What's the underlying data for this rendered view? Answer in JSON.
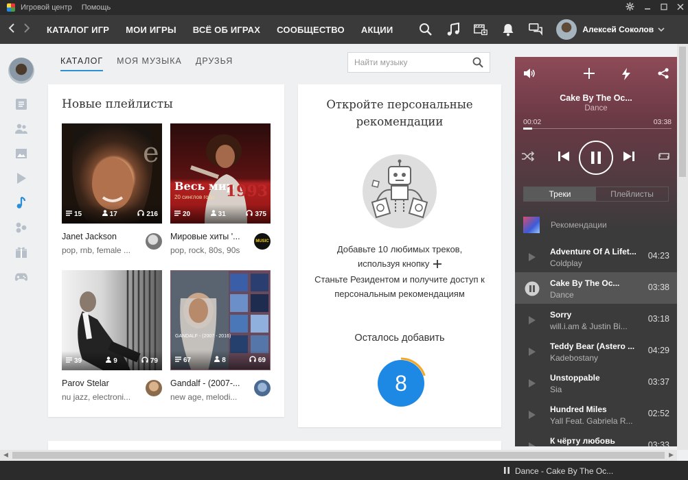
{
  "titlebar": {
    "menu": [
      "Игровой центр",
      "Помощь"
    ]
  },
  "navbar": {
    "items": [
      "КАТАЛОГ ИГР",
      "МОИ ИГРЫ",
      "ВСЁ ОБ ИГРАХ",
      "СООБЩЕСТВО",
      "АКЦИИ"
    ],
    "icons": [
      "search-icon",
      "music-icon",
      "video-icon",
      "bell-icon",
      "chat-icon"
    ],
    "user_name": "Алексей Соколов"
  },
  "sidebar": {
    "icons": [
      "news-icon",
      "friends-icon",
      "photos-icon",
      "video-icon",
      "music-icon",
      "groups-icon",
      "gifts-icon",
      "games-icon"
    ],
    "active": "music-icon",
    "accent_color": "#2b8fd6"
  },
  "tabs": [
    "КАТАЛОГ",
    "МОЯ МУЗЫКА",
    "ДРУЗЬЯ"
  ],
  "search": {
    "placeholder": "Найти музыку"
  },
  "playlists": {
    "title": "Новые плейлисты",
    "items": [
      {
        "title": "Janet Jackson",
        "tags": "pop, rnb, female ...",
        "tracks": "15",
        "followers": "17",
        "listens": "216"
      },
      {
        "title": "Мировые хиты '...",
        "tags": "pop, rock, 80s, 90s",
        "tracks": "20",
        "followers": "31",
        "listens": "375",
        "cover_text": "Весь мир",
        "cover_sub": "20 синглов года",
        "cover_year": "1993",
        "author_badge": "MUSIC"
      },
      {
        "title": "Parov Stelar",
        "tags": "nu jazz, electroni...",
        "tracks": "39",
        "followers": "9",
        "listens": "79"
      },
      {
        "title": "Gandalf - (2007-...",
        "tags": "new age, melodi...",
        "tracks": "67",
        "followers": "8",
        "listens": "69",
        "cover_text": "GANDALF - (2007 - 2016)"
      }
    ]
  },
  "recommendations": {
    "title": "Откройте персональные рекомендации",
    "line1": "Добавьте 10 любимых треков,",
    "line2": "используя кнопку",
    "line3": "Станьте Резидентом и получите доступ к персональным рекомендациям",
    "remaining_label": "Осталось добавить",
    "remaining": "8",
    "progress": 0.2,
    "counter_color": "#1e88e5",
    "ring_color": "#f5a623"
  },
  "player": {
    "title": "Cake By The Oc...",
    "genre": "Dance",
    "elapsed": "00:02",
    "total": "03:38",
    "progress": 0.01,
    "tabs": [
      "Треки",
      "Плейлисты"
    ],
    "active_tab": "Треки",
    "section": "Рекомендации",
    "tracks": [
      {
        "name": "Adventure Of A Lifet...",
        "artist": "Coldplay",
        "duration": "04:23"
      },
      {
        "name": "Cake By The Oc...",
        "artist": "Dance",
        "duration": "03:38",
        "playing": true
      },
      {
        "name": "Sorry",
        "artist": "will.i.am & Justin Bi...",
        "duration": "03:18"
      },
      {
        "name": "Teddy Bear (Astero ...",
        "artist": "Kadebostany",
        "duration": "04:29"
      },
      {
        "name": "Unstoppable",
        "artist": "Sia",
        "duration": "03:37"
      },
      {
        "name": "Hundred Miles",
        "artist": "Yall Feat. Gabriela R...",
        "duration": "02:52"
      },
      {
        "name": "К чёрту любовь",
        "artist": "",
        "duration": "03:33"
      }
    ]
  },
  "statusbar": {
    "now_playing": "Dance - Cake By The Oc..."
  }
}
